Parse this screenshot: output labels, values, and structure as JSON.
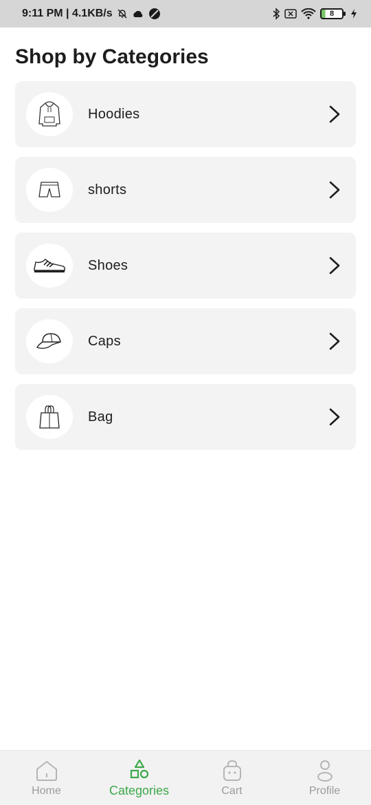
{
  "status_bar": {
    "time_speed": "9:11 PM | 4.1KB/s",
    "battery": "8"
  },
  "page": {
    "title": "Shop by Categories"
  },
  "categories": [
    {
      "label": "Hoodies",
      "icon": "hoodie-icon"
    },
    {
      "label": "shorts",
      "icon": "shorts-icon"
    },
    {
      "label": "Shoes",
      "icon": "shoe-icon"
    },
    {
      "label": "Caps",
      "icon": "cap-icon"
    },
    {
      "label": "Bag",
      "icon": "bag-icon"
    }
  ],
  "bottom_nav": {
    "items": [
      {
        "label": "Home",
        "icon": "home-icon"
      },
      {
        "label": "Categories",
        "icon": "categories-icon"
      },
      {
        "label": "Cart",
        "icon": "cart-icon"
      },
      {
        "label": "Profile",
        "icon": "profile-icon"
      }
    ],
    "active": "Categories"
  },
  "colors": {
    "accent": "#3ca84a",
    "card_bg": "#f3f3f3",
    "status_bg": "#d6d6d6",
    "nav_bg": "#f2f2f2",
    "inactive": "#9b9b9b"
  }
}
